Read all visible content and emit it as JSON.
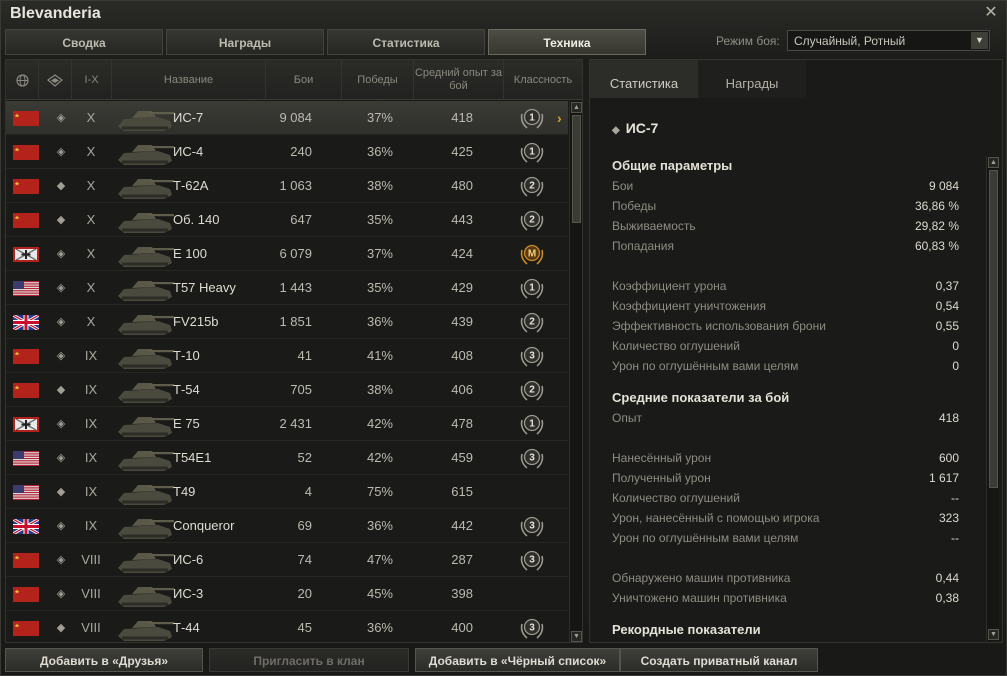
{
  "window": {
    "title": "Blevanderia"
  },
  "tabs": [
    "Сводка",
    "Награды",
    "Статистика",
    "Техника"
  ],
  "active_tab": 3,
  "battle_mode": {
    "label": "Режим боя:",
    "value": "Случайный, Ротный"
  },
  "table": {
    "headers": {
      "nation": "",
      "type": "",
      "tier": "I-X",
      "name": "Название",
      "battles": "Бои",
      "wins": "Победы",
      "avg_xp": "Средний опыт за бой",
      "mastery": "Классность"
    },
    "rows": [
      {
        "nation": "ussr",
        "type": "heavy",
        "tier": "X",
        "name": "ИС-7",
        "battles": "9 084",
        "wins": "37%",
        "xp": "418",
        "mastery": "1",
        "selected": true
      },
      {
        "nation": "ussr",
        "type": "heavy",
        "tier": "X",
        "name": "ИС-4",
        "battles": "240",
        "wins": "36%",
        "xp": "425",
        "mastery": "1"
      },
      {
        "nation": "ussr",
        "type": "medium",
        "tier": "X",
        "name": "Т-62А",
        "battles": "1 063",
        "wins": "38%",
        "xp": "480",
        "mastery": "2"
      },
      {
        "nation": "ussr",
        "type": "medium",
        "tier": "X",
        "name": "Об. 140",
        "battles": "647",
        "wins": "35%",
        "xp": "443",
        "mastery": "2"
      },
      {
        "nation": "germany",
        "type": "heavy",
        "tier": "X",
        "name": "E 100",
        "battles": "6 079",
        "wins": "37%",
        "xp": "424",
        "mastery": "M"
      },
      {
        "nation": "usa",
        "type": "heavy",
        "tier": "X",
        "name": "T57 Heavy",
        "battles": "1 443",
        "wins": "35%",
        "xp": "429",
        "mastery": "1"
      },
      {
        "nation": "uk",
        "type": "heavy",
        "tier": "X",
        "name": "FV215b",
        "battles": "1 851",
        "wins": "36%",
        "xp": "439",
        "mastery": "2"
      },
      {
        "nation": "ussr",
        "type": "heavy",
        "tier": "IX",
        "name": "Т-10",
        "battles": "41",
        "wins": "41%",
        "xp": "408",
        "mastery": "3"
      },
      {
        "nation": "ussr",
        "type": "medium",
        "tier": "IX",
        "name": "Т-54",
        "battles": "705",
        "wins": "38%",
        "xp": "406",
        "mastery": "2"
      },
      {
        "nation": "germany",
        "type": "heavy",
        "tier": "IX",
        "name": "E 75",
        "battles": "2 431",
        "wins": "42%",
        "xp": "478",
        "mastery": "1"
      },
      {
        "nation": "usa",
        "type": "heavy",
        "tier": "IX",
        "name": "T54E1",
        "battles": "52",
        "wins": "42%",
        "xp": "459",
        "mastery": "3"
      },
      {
        "nation": "usa",
        "type": "medium",
        "tier": "IX",
        "name": "T49",
        "battles": "4",
        "wins": "75%",
        "xp": "615",
        "mastery": ""
      },
      {
        "nation": "uk",
        "type": "heavy",
        "tier": "IX",
        "name": "Conqueror",
        "battles": "69",
        "wins": "36%",
        "xp": "442",
        "mastery": "3"
      },
      {
        "nation": "ussr",
        "type": "heavy",
        "tier": "VIII",
        "name": "ИС-6",
        "battles": "74",
        "wins": "47%",
        "xp": "287",
        "mastery": "3"
      },
      {
        "nation": "ussr",
        "type": "heavy",
        "tier": "VIII",
        "name": "ИС-3",
        "battles": "20",
        "wins": "45%",
        "xp": "398",
        "mastery": ""
      },
      {
        "nation": "ussr",
        "type": "medium",
        "tier": "VIII",
        "name": "Т-44",
        "battles": "45",
        "wins": "36%",
        "xp": "400",
        "mastery": "3"
      }
    ]
  },
  "detail": {
    "tabs": [
      "Статистика",
      "Награды"
    ],
    "title": "ИС-7",
    "sections": [
      {
        "header": "Общие параметры",
        "items": [
          {
            "label": "Бои",
            "value": "9 084"
          },
          {
            "label": "Победы",
            "value": "36,86 %"
          },
          {
            "label": "Выживаемость",
            "value": "29,82 %"
          },
          {
            "label": "Попадания",
            "value": "60,83 %"
          },
          {
            "gap": true
          },
          {
            "label": "Коэффициент урона",
            "value": "0,37"
          },
          {
            "label": "Коэффициент уничтожения",
            "value": "0,54"
          },
          {
            "label": "Эффективность использования брони",
            "value": "0,55"
          },
          {
            "label": "Количество оглушений",
            "value": "0"
          },
          {
            "label": "Урон по оглушённым вами целям",
            "value": "0"
          }
        ]
      },
      {
        "header": "Средние показатели за бой",
        "items": [
          {
            "label": "Опыт",
            "value": "418"
          },
          {
            "gap": true
          },
          {
            "label": "Нанесённый урон",
            "value": "600"
          },
          {
            "label": "Полученный урон",
            "value": "1 617"
          },
          {
            "label": "Количество оглушений",
            "value": "--"
          },
          {
            "label": "Урон, нанесённый с помощью игрока",
            "value": "323"
          },
          {
            "label": "Урон по оглушённым вами целям",
            "value": "--"
          },
          {
            "gap": true
          },
          {
            "label": "Обнаружено машин противника",
            "value": "0,44"
          },
          {
            "label": "Уничтожено машин противника",
            "value": "0,38"
          }
        ]
      },
      {
        "header": "Рекордные показатели",
        "items": []
      }
    ]
  },
  "buttons": {
    "add_friend": "Добавить в «Друзья»",
    "invite_clan": "Пригласить в клан",
    "add_blacklist": "Добавить в «Чёрный список»",
    "private_channel": "Создать приватный канал"
  },
  "colors": {
    "accent": "#e39b2b",
    "selected_row": "#3b3b36"
  }
}
